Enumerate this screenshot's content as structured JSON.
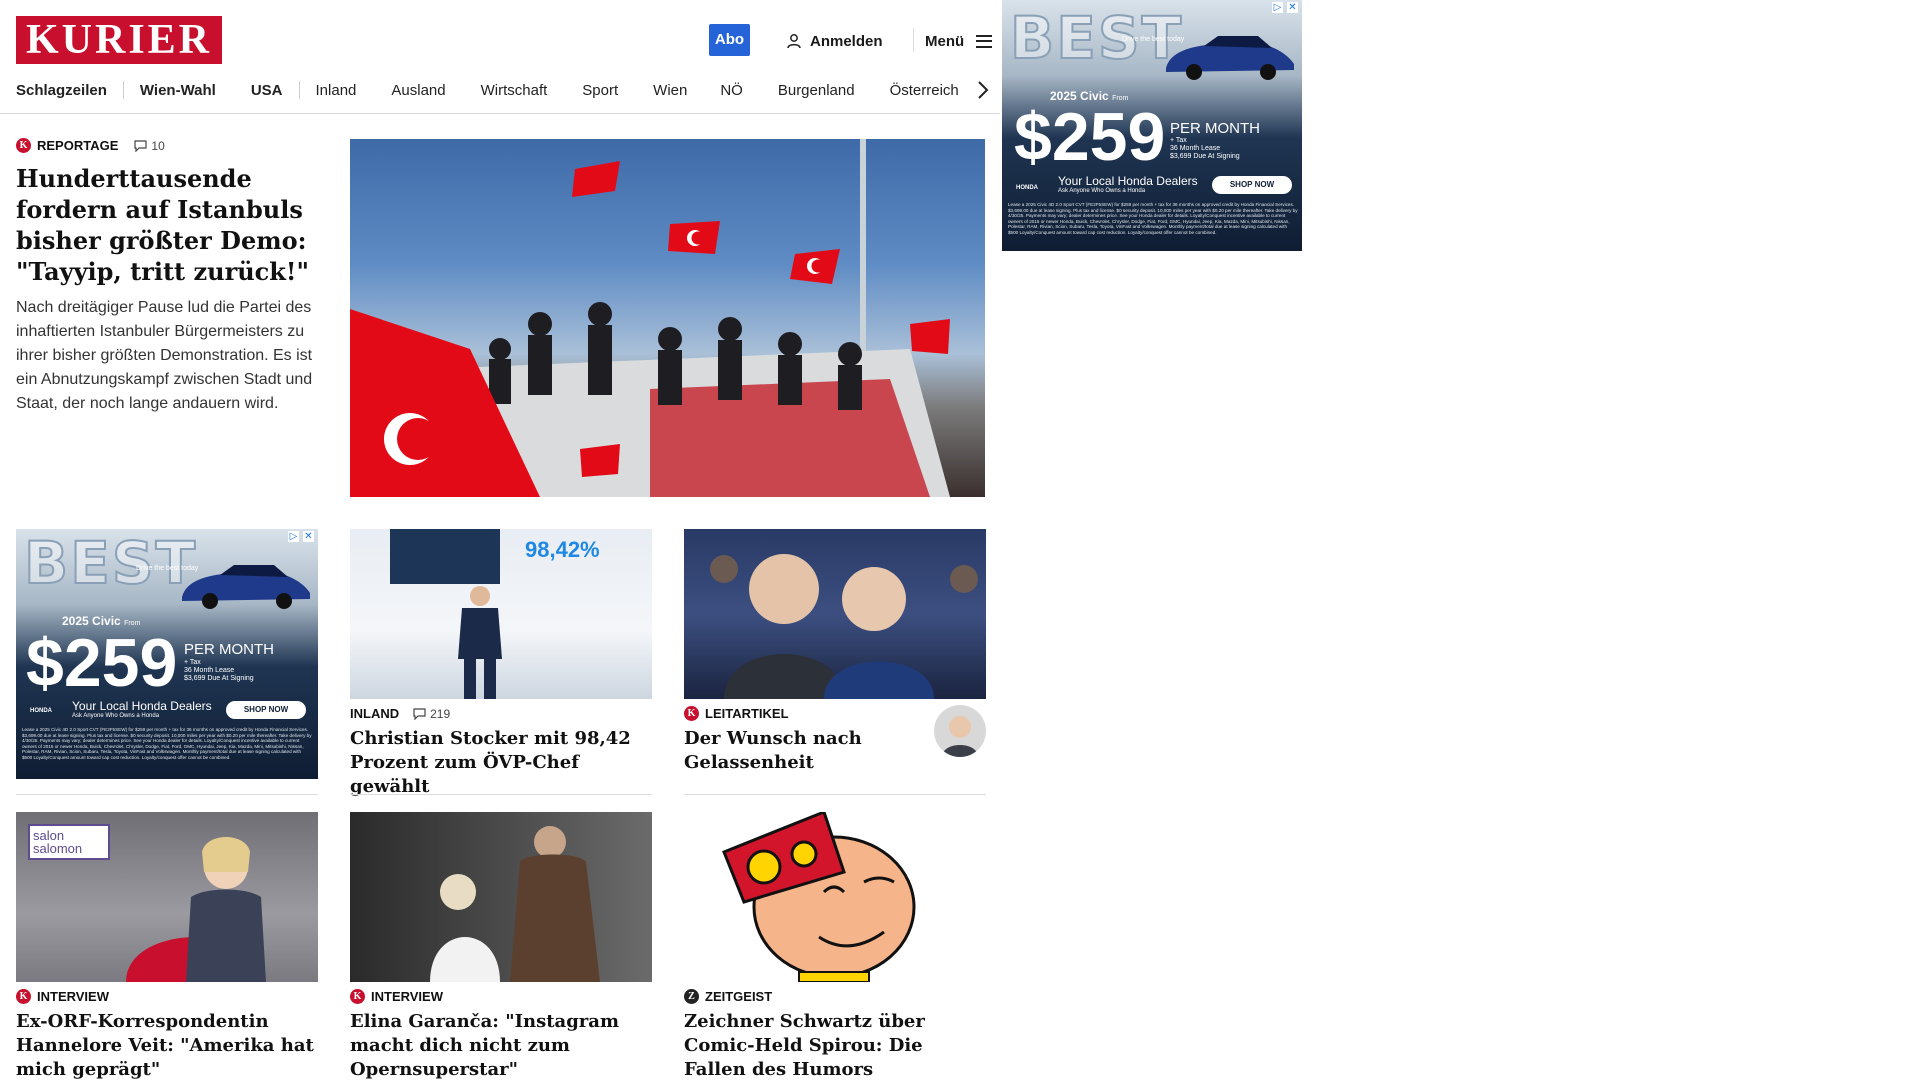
{
  "header": {
    "logo": "KURIER",
    "abo": "Abo",
    "login": "Anmelden",
    "menu": "Menü"
  },
  "nav": [
    "Schlagzeilen",
    "Wien-Wahl",
    "USA",
    "Inland",
    "Ausland",
    "Wirtschaft",
    "Sport",
    "Wien",
    "NÖ",
    "Burgenland",
    "Österreich"
  ],
  "lead": {
    "kicker": "REPORTAGE",
    "comments": "10",
    "headline": "Hunderttausende fordern auf Istanbuls bisher größter Demo: \"Tayyip, tritt zurück!\"",
    "teaser": "Nach dreitägiger Pause lud die Partei des inhaftierten Istanbuler Bürgermeisters zu ihrer bisher größten Demonstration. Es ist ein Abnutzungskampf zwischen Stadt und Staat, der noch lange andauern wird."
  },
  "cards": [
    {
      "kicker": "INLAND",
      "comments": "219",
      "headline": "Christian Stocker mit 98,42 Prozent zum ÖVP-Chef gewählt",
      "image_text": "98,42%"
    },
    {
      "kicker": "LEITARTIKEL",
      "headline": "Der Wunsch nach Gelassenheit"
    },
    {
      "kicker": "INTERVIEW",
      "headline": "Ex-ORF-Korrespondentin Hannelore Veit: \"Amerika hat mich geprägt\"",
      "image_text": "salon salomon"
    },
    {
      "kicker": "INTERVIEW",
      "headline": "Elina Garanča: \"Instagram macht dich nicht zum Opernsuperstar\""
    },
    {
      "kicker": "ZEITGEIST",
      "headline": "Zeichner Schwartz über Comic-Held Spirou: Die Fallen des Humors"
    }
  ],
  "ad": {
    "best": "BEST",
    "tagline": "Drive the best today",
    "model": "2025 Civic",
    "from": "From",
    "price": "$259",
    "per_month": "PER MONTH",
    "tax": "+ Tax",
    "lease": "36 Month Lease",
    "due": "$3,699 Due At Signing",
    "brand": "HONDA",
    "dealer": "Your Local Honda Dealers",
    "dealer_sub": "Ask Anyone Who Owns a Honda",
    "cta": "SHOP NOW",
    "fine": "Lease a 2025 Civic 4D 2.0 Sport CVT (FE2F5SEW) for $259 per month + tax for 36 months on approved credit by Honda Financial Services. $3,699.00 due at lease signing. Plus tax and license. $0 security deposit. 10,000 miles per year with $0.20 per mile thereafter. Take delivery by 4/30/25. Payments may vary; dealer determines price. See your Honda dealer for details. Loyalty/Conquest incentive available to current owners of 2015 or newer Honda, Buick, Chevrolet, Chrysler, Dodge, Fiat, Ford, GMC, Hyundai, Jeep, Kia, Mazda, Mini, Mitsubishi, Nissan, Polestar, RAM, Rivian, Scion, Subaru, Tesla, Toyota, VinFast and Volkswagen. Monthly payment/total due at lease signing calculated with $500 Loyalty/Conquest amount toward cap cost reduction. Loyalty/conquest offer cannot be combined."
  },
  "colors": {
    "brand_red": "#c8102e",
    "abo_blue": "#2563d8",
    "ad_navy": "#0f1d33"
  }
}
